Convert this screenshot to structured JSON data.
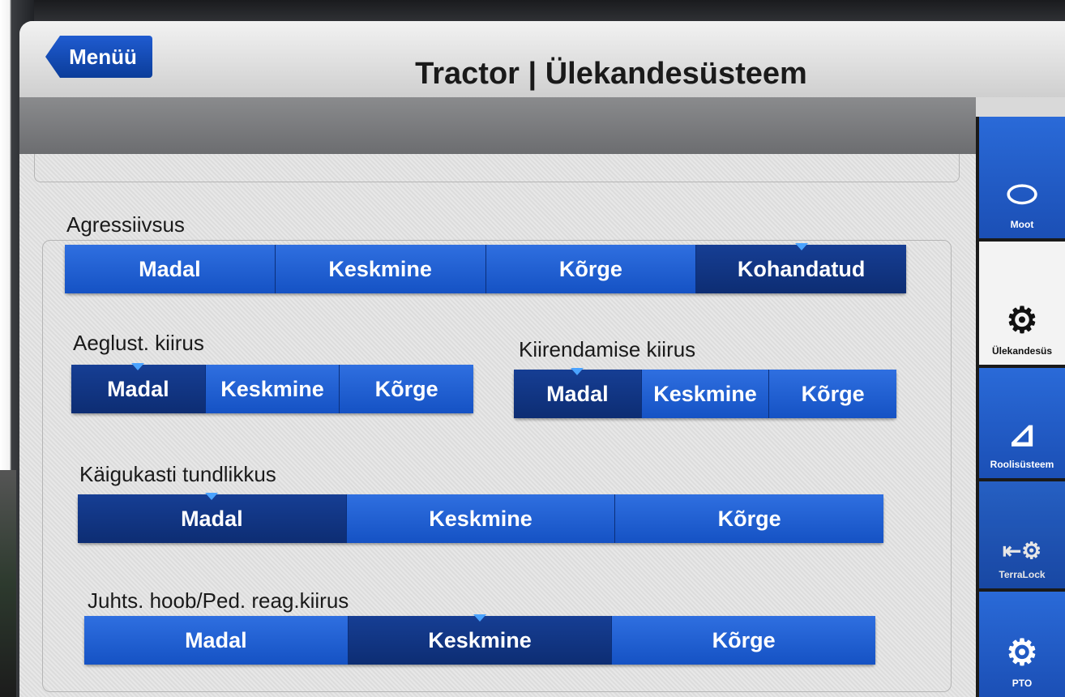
{
  "header": {
    "menu_label": "Menüü",
    "title": "Tractor | Ülekandesüsteem"
  },
  "sections": {
    "aggressiveness": {
      "label": "Agressiivsus",
      "options": [
        "Madal",
        "Keskmine",
        "Kõrge",
        "Kohandatud"
      ],
      "selected": "Kohandatud"
    },
    "deceleration": {
      "label": "Aeglust. kiirus",
      "options": [
        "Madal",
        "Keskmine",
        "Kõrge"
      ],
      "selected": "Madal"
    },
    "acceleration": {
      "label": "Kiirendamise kiirus",
      "options": [
        "Madal",
        "Keskmine",
        "Kõrge"
      ],
      "selected": "Madal"
    },
    "gearbox_sensitivity": {
      "label": "Käigukasti tundlikkus",
      "options": [
        "Madal",
        "Keskmine",
        "Kõrge"
      ],
      "selected": "Madal"
    },
    "lever_pedal_response": {
      "label": "Juhts. hoob/Ped. reag.kiirus",
      "options": [
        "Madal",
        "Keskmine",
        "Kõrge"
      ],
      "selected": "Keskmine"
    }
  },
  "sidebar": {
    "items": [
      {
        "label": "Moot",
        "icon": "engine-icon"
      },
      {
        "label": "Ülekandesüs",
        "icon": "transmission-gear-icon"
      },
      {
        "label": "Roolisüsteem",
        "icon": "steering-icon"
      },
      {
        "label": "TerraLock",
        "icon": "terralock-icon"
      },
      {
        "label": "PTO",
        "icon": "pto-icon"
      }
    ]
  },
  "colors": {
    "button_blue": "#1f5fd4",
    "button_selected": "#0f3380",
    "selected_marker": "#4aa3ff"
  }
}
